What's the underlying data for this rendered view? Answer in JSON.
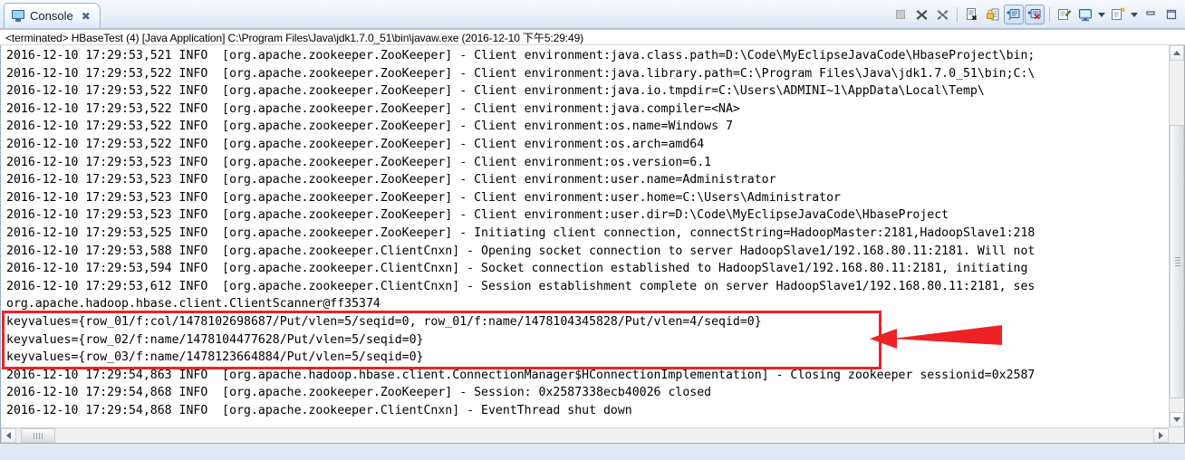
{
  "window": {
    "tab": {
      "label": "Console",
      "icon": "console-monitor-icon",
      "close_glyph": "✖"
    },
    "process_line": "<terminated> HBaseTest (4) [Java Application] C:\\Program Files\\Java\\jdk1.7.0_51\\bin\\javaw.exe (2016-12-10 下午5:29:49)"
  },
  "toolbar": {
    "buttons": [
      {
        "name": "terminate-button",
        "icon": "stop-square-icon",
        "tooltip": "Terminate",
        "enabled": false,
        "pressed": false
      },
      {
        "name": "remove-launch-button",
        "icon": "remove-x-icon",
        "tooltip": "Remove Launch",
        "enabled": true,
        "pressed": false
      },
      {
        "name": "remove-all-launches-button",
        "icon": "remove-all-xx-icon",
        "tooltip": "Remove All Terminated Launches",
        "enabled": true,
        "pressed": false
      },
      {
        "name": "separator-1",
        "icon": "separator",
        "tooltip": "",
        "enabled": true,
        "pressed": false
      },
      {
        "name": "clear-console-button",
        "icon": "clear-console-icon",
        "tooltip": "Clear Console",
        "enabled": true,
        "pressed": false
      },
      {
        "name": "scroll-lock-button",
        "icon": "scroll-lock-padlock-icon",
        "tooltip": "Scroll Lock",
        "enabled": true,
        "pressed": false
      },
      {
        "name": "show-console-on-output-button",
        "icon": "show-console-output-icon",
        "tooltip": "Show Console When Standard Out Changes",
        "enabled": true,
        "pressed": true
      },
      {
        "name": "show-console-on-error-button",
        "icon": "show-console-error-icon",
        "tooltip": "Show Console When Standard Error Changes",
        "enabled": true,
        "pressed": true
      },
      {
        "name": "separator-2",
        "icon": "separator",
        "tooltip": "",
        "enabled": true,
        "pressed": false
      },
      {
        "name": "pin-console-button",
        "icon": "pin-console-icon",
        "tooltip": "Pin Console",
        "enabled": true,
        "pressed": false
      },
      {
        "name": "display-selected-console-button",
        "icon": "display-console-icon",
        "tooltip": "Display Selected Console",
        "enabled": true,
        "pressed": false
      },
      {
        "name": "display-console-menu-arrow",
        "icon": "chevron-down-icon",
        "tooltip": "",
        "enabled": true,
        "pressed": false
      },
      {
        "name": "open-console-button",
        "icon": "new-console-icon",
        "tooltip": "Open Console",
        "enabled": true,
        "pressed": false
      },
      {
        "name": "open-console-menu-arrow",
        "icon": "chevron-down-icon",
        "tooltip": "",
        "enabled": true,
        "pressed": false
      },
      {
        "name": "minimize-button",
        "icon": "minimize-icon",
        "tooltip": "Minimize",
        "enabled": true,
        "pressed": false
      },
      {
        "name": "maximize-button",
        "icon": "maximize-icon",
        "tooltip": "Maximize",
        "enabled": true,
        "pressed": false
      }
    ]
  },
  "console": {
    "lines": [
      "2016-12-10 17:29:53,521 INFO  [org.apache.zookeeper.ZooKeeper] - Client environment:java.class.path=D:\\Code\\MyEclipseJavaCode\\HbaseProject\\bin;",
      "2016-12-10 17:29:53,522 INFO  [org.apache.zookeeper.ZooKeeper] - Client environment:java.library.path=C:\\Program Files\\Java\\jdk1.7.0_51\\bin;C:\\",
      "2016-12-10 17:29:53,522 INFO  [org.apache.zookeeper.ZooKeeper] - Client environment:java.io.tmpdir=C:\\Users\\ADMINI~1\\AppData\\Local\\Temp\\",
      "2016-12-10 17:29:53,522 INFO  [org.apache.zookeeper.ZooKeeper] - Client environment:java.compiler=<NA>",
      "2016-12-10 17:29:53,522 INFO  [org.apache.zookeeper.ZooKeeper] - Client environment:os.name=Windows 7",
      "2016-12-10 17:29:53,522 INFO  [org.apache.zookeeper.ZooKeeper] - Client environment:os.arch=amd64",
      "2016-12-10 17:29:53,523 INFO  [org.apache.zookeeper.ZooKeeper] - Client environment:os.version=6.1",
      "2016-12-10 17:29:53,523 INFO  [org.apache.zookeeper.ZooKeeper] - Client environment:user.name=Administrator",
      "2016-12-10 17:29:53,523 INFO  [org.apache.zookeeper.ZooKeeper] - Client environment:user.home=C:\\Users\\Administrator",
      "2016-12-10 17:29:53,523 INFO  [org.apache.zookeeper.ZooKeeper] - Client environment:user.dir=D:\\Code\\MyEclipseJavaCode\\HbaseProject",
      "2016-12-10 17:29:53,525 INFO  [org.apache.zookeeper.ZooKeeper] - Initiating client connection, connectString=HadoopMaster:2181,HadoopSlave1:218",
      "2016-12-10 17:29:53,588 INFO  [org.apache.zookeeper.ClientCnxn] - Opening socket connection to server HadoopSlave1/192.168.80.11:2181. Will not",
      "2016-12-10 17:29:53,594 INFO  [org.apache.zookeeper.ClientCnxn] - Socket connection established to HadoopSlave1/192.168.80.11:2181, initiating",
      "2016-12-10 17:29:53,612 INFO  [org.apache.zookeeper.ClientCnxn] - Session establishment complete on server HadoopSlave1/192.168.80.11:2181, ses",
      "org.apache.hadoop.hbase.client.ClientScanner@ff35374",
      "keyvalues={row_01/f:col/1478102698687/Put/vlen=5/seqid=0, row_01/f:name/1478104345828/Put/vlen=4/seqid=0}",
      "keyvalues={row_02/f:name/1478104477628/Put/vlen=5/seqid=0}",
      "keyvalues={row_03/f:name/1478123664884/Put/vlen=5/seqid=0}",
      "2016-12-10 17:29:54,863 INFO  [org.apache.hadoop.hbase.client.ConnectionManager$HConnectionImplementation] - Closing zookeeper sessionid=0x2587",
      "2016-12-10 17:29:54,868 INFO  [org.apache.zookeeper.ZooKeeper] - Session: 0x2587338ecb40026 closed",
      "2016-12-10 17:29:54,868 INFO  [org.apache.zookeeper.ClientCnxn] - EventThread shut down"
    ]
  },
  "annotation": {
    "highlight_color": "#ec2227",
    "highlight_label": "keyvalues-result-highlight",
    "arrow_label": "red-pointer-arrow",
    "highlight_line_indices": [
      15,
      16,
      17
    ]
  },
  "scrollbars": {
    "vertical": {
      "up_glyph": "▲",
      "down_glyph": "▼"
    },
    "horizontal": {
      "left_glyph": "◀",
      "right_glyph": "▶"
    }
  }
}
